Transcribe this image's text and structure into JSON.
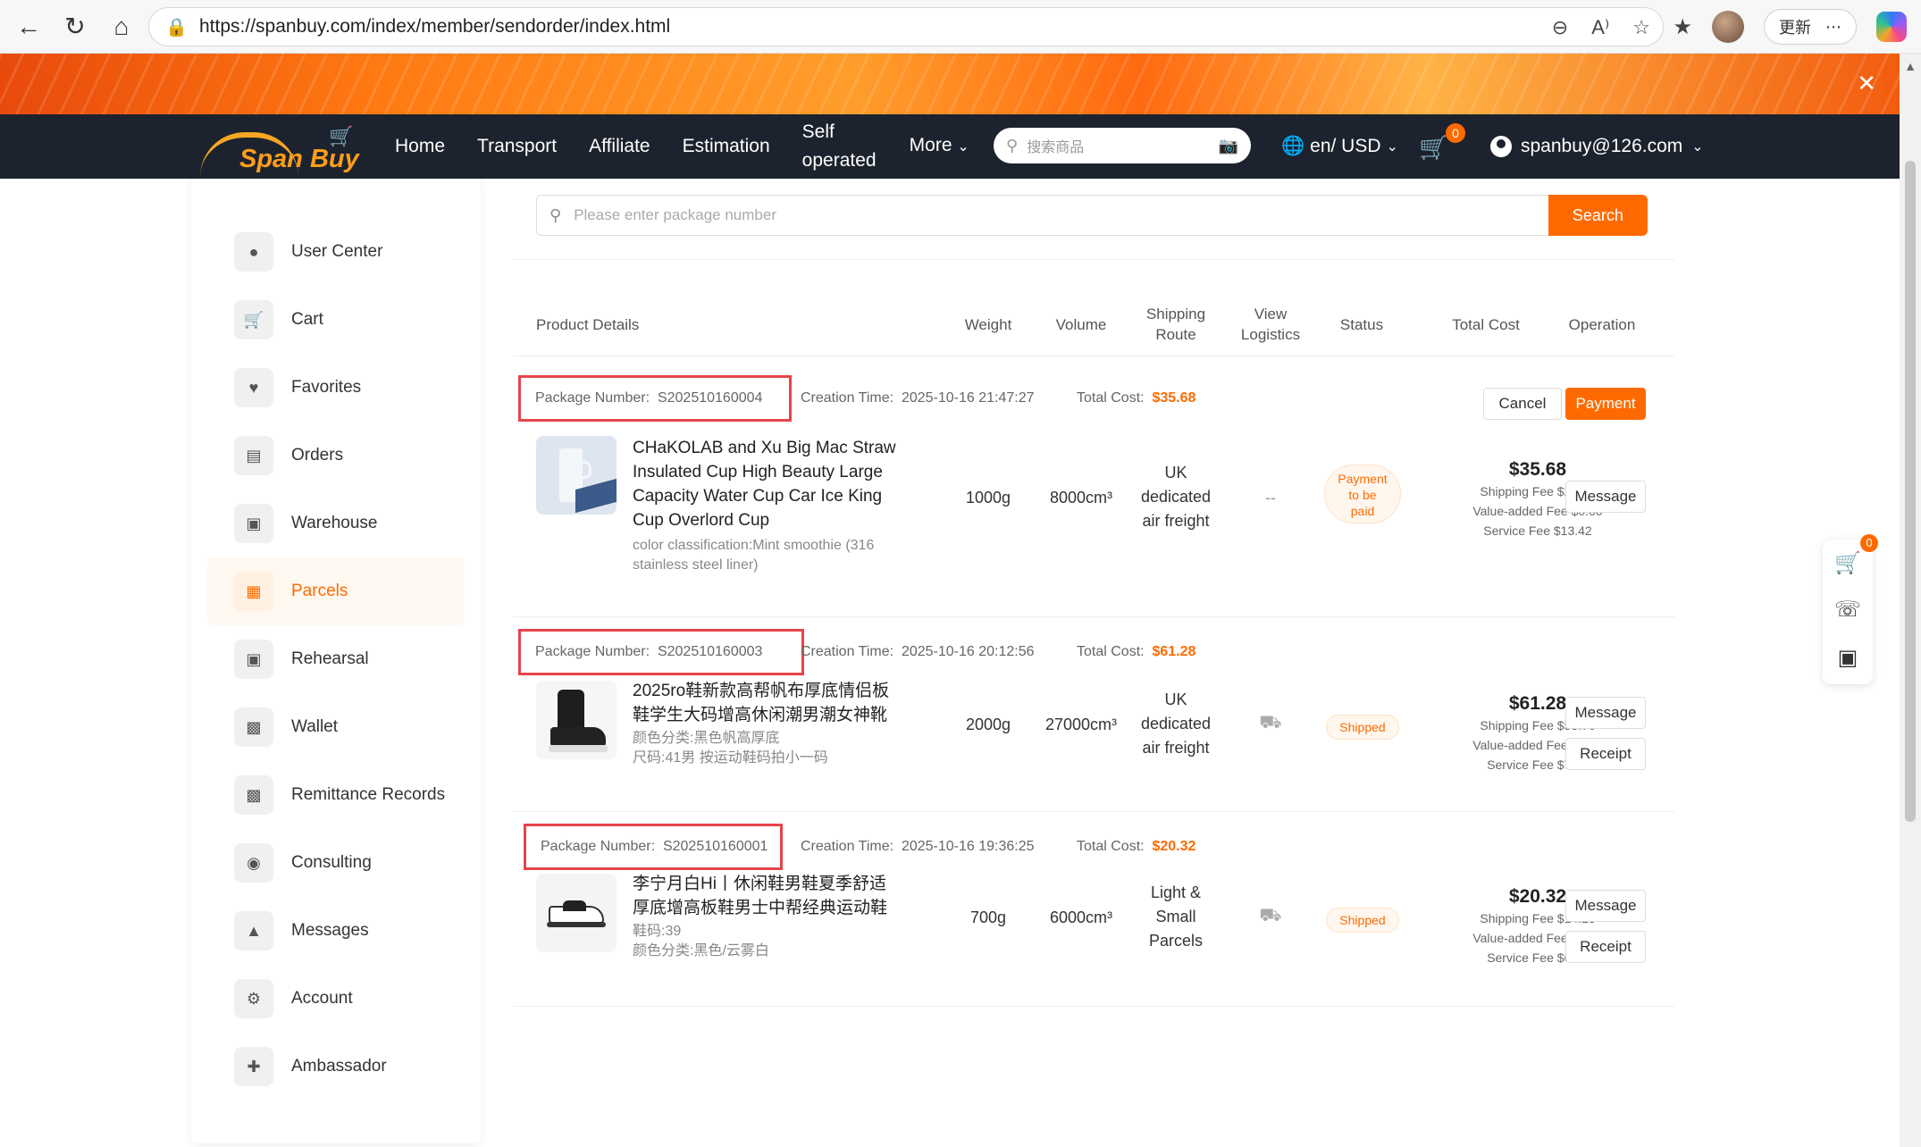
{
  "browser": {
    "url": "https://spanbuy.com/index/member/sendorder/index.html",
    "update_label": "更新"
  },
  "header": {
    "logo_text": "Span Buy",
    "nav": [
      "Home",
      "Transport",
      "Affiliate",
      "Estimation"
    ],
    "nav_self_1": "Self",
    "nav_self_2": "operated",
    "nav_more": "More",
    "search_placeholder": "搜索商品",
    "lang": "en/ USD",
    "cart_count": "0",
    "account": "spanbuy@126.com"
  },
  "sidebar": {
    "items": [
      {
        "label": "User Center",
        "icon": "user-icon"
      },
      {
        "label": "Cart",
        "icon": "cart-icon"
      },
      {
        "label": "Favorites",
        "icon": "heart-icon"
      },
      {
        "label": "Orders",
        "icon": "document-icon"
      },
      {
        "label": "Warehouse",
        "icon": "archive-icon"
      },
      {
        "label": "Parcels",
        "icon": "parcel-icon"
      },
      {
        "label": "Rehearsal",
        "icon": "archive-icon"
      },
      {
        "label": "Wallet",
        "icon": "wallet-icon"
      },
      {
        "label": "Remittance Records",
        "icon": "wallet-icon"
      },
      {
        "label": "Consulting",
        "icon": "chat-icon"
      },
      {
        "label": "Messages",
        "icon": "bell-icon"
      },
      {
        "label": "Account",
        "icon": "gear-icon"
      },
      {
        "label": "Ambassador",
        "icon": "user-plus-icon"
      }
    ],
    "active": "Parcels"
  },
  "search": {
    "placeholder": "Please enter package number",
    "button": "Search"
  },
  "table": {
    "headers": {
      "product": "Product Details",
      "weight": "Weight",
      "volume": "Volume",
      "route_1": "Shipping",
      "route_2": "Route",
      "logistics_1": "View",
      "logistics_2": "Logistics",
      "status": "Status",
      "total": "Total Cost",
      "operation": "Operation"
    }
  },
  "labels": {
    "package_number": "Package Number:",
    "creation_time": "Creation Time:",
    "total_cost": "Total Cost:",
    "cancel": "Cancel",
    "payment": "Payment",
    "message": "Message",
    "receipt": "Receipt"
  },
  "packages": [
    {
      "number": "S202510160004",
      "created": "2025-10-16 21:47:27",
      "total": "$35.68",
      "title": "CHaKOLAB and Xu Big Mac Straw Insulated Cup High Beauty Large Capacity Water Cup Car Ice King Cup Overlord Cup",
      "sub": "color classification:Mint smoothie (316 stainless steel liner)",
      "weight": "1000g",
      "volume": "8000cm³",
      "route": [
        "UK",
        "dedicated",
        "air freight"
      ],
      "logistics": "--",
      "status": [
        "Payment",
        "to be",
        "paid"
      ],
      "price": "$35.68",
      "shipping_fee": "Shipping Fee $22.26",
      "value_added_fee": "Value-added Fee $0.00",
      "service_fee": "Service Fee $13.42"
    },
    {
      "number": "S202510160003",
      "created": "2025-10-16 20:12:56",
      "total": "$61.28",
      "title": "2025ro鞋新款高帮帆布厚底情侣板鞋学生大码增高休闲潮男潮女神靴",
      "sub1": "颜色分类:黑色帆高厚底",
      "sub2": "尺码:41男 按运动鞋码拍小一码",
      "weight": "2000g",
      "volume": "27000cm³",
      "route": [
        "UK",
        "dedicated",
        "air freight"
      ],
      "status": "Shipped",
      "price": "$61.28",
      "shipping_fee": "Shipping Fee $53.76",
      "value_added_fee": "Value-added Fee $0.00",
      "service_fee": "Service Fee $7.52"
    },
    {
      "number": "S202510160001",
      "created": "2025-10-16 19:36:25",
      "total": "$20.32",
      "title": "李宁月白Hi丨休闲鞋男鞋夏季舒适厚底增高板鞋男士中帮经典运动鞋",
      "sub1": "鞋码:39",
      "sub2": "颜色分类:黑色/云雾白",
      "weight": "700g",
      "volume": "6000cm³",
      "route": [
        "Light &",
        "Small",
        "Parcels"
      ],
      "status": "Shipped",
      "price": "$20.32",
      "shipping_fee": "Shipping Fee $14.25",
      "value_added_fee": "Value-added Fee $0.00",
      "service_fee": "Service Fee $6.07"
    }
  ],
  "float_widget": {
    "cart_count": "0"
  },
  "colors": {
    "accent": "#ff6a00",
    "header_bg": "#1c232e",
    "highlight_box": "#e8434a"
  }
}
